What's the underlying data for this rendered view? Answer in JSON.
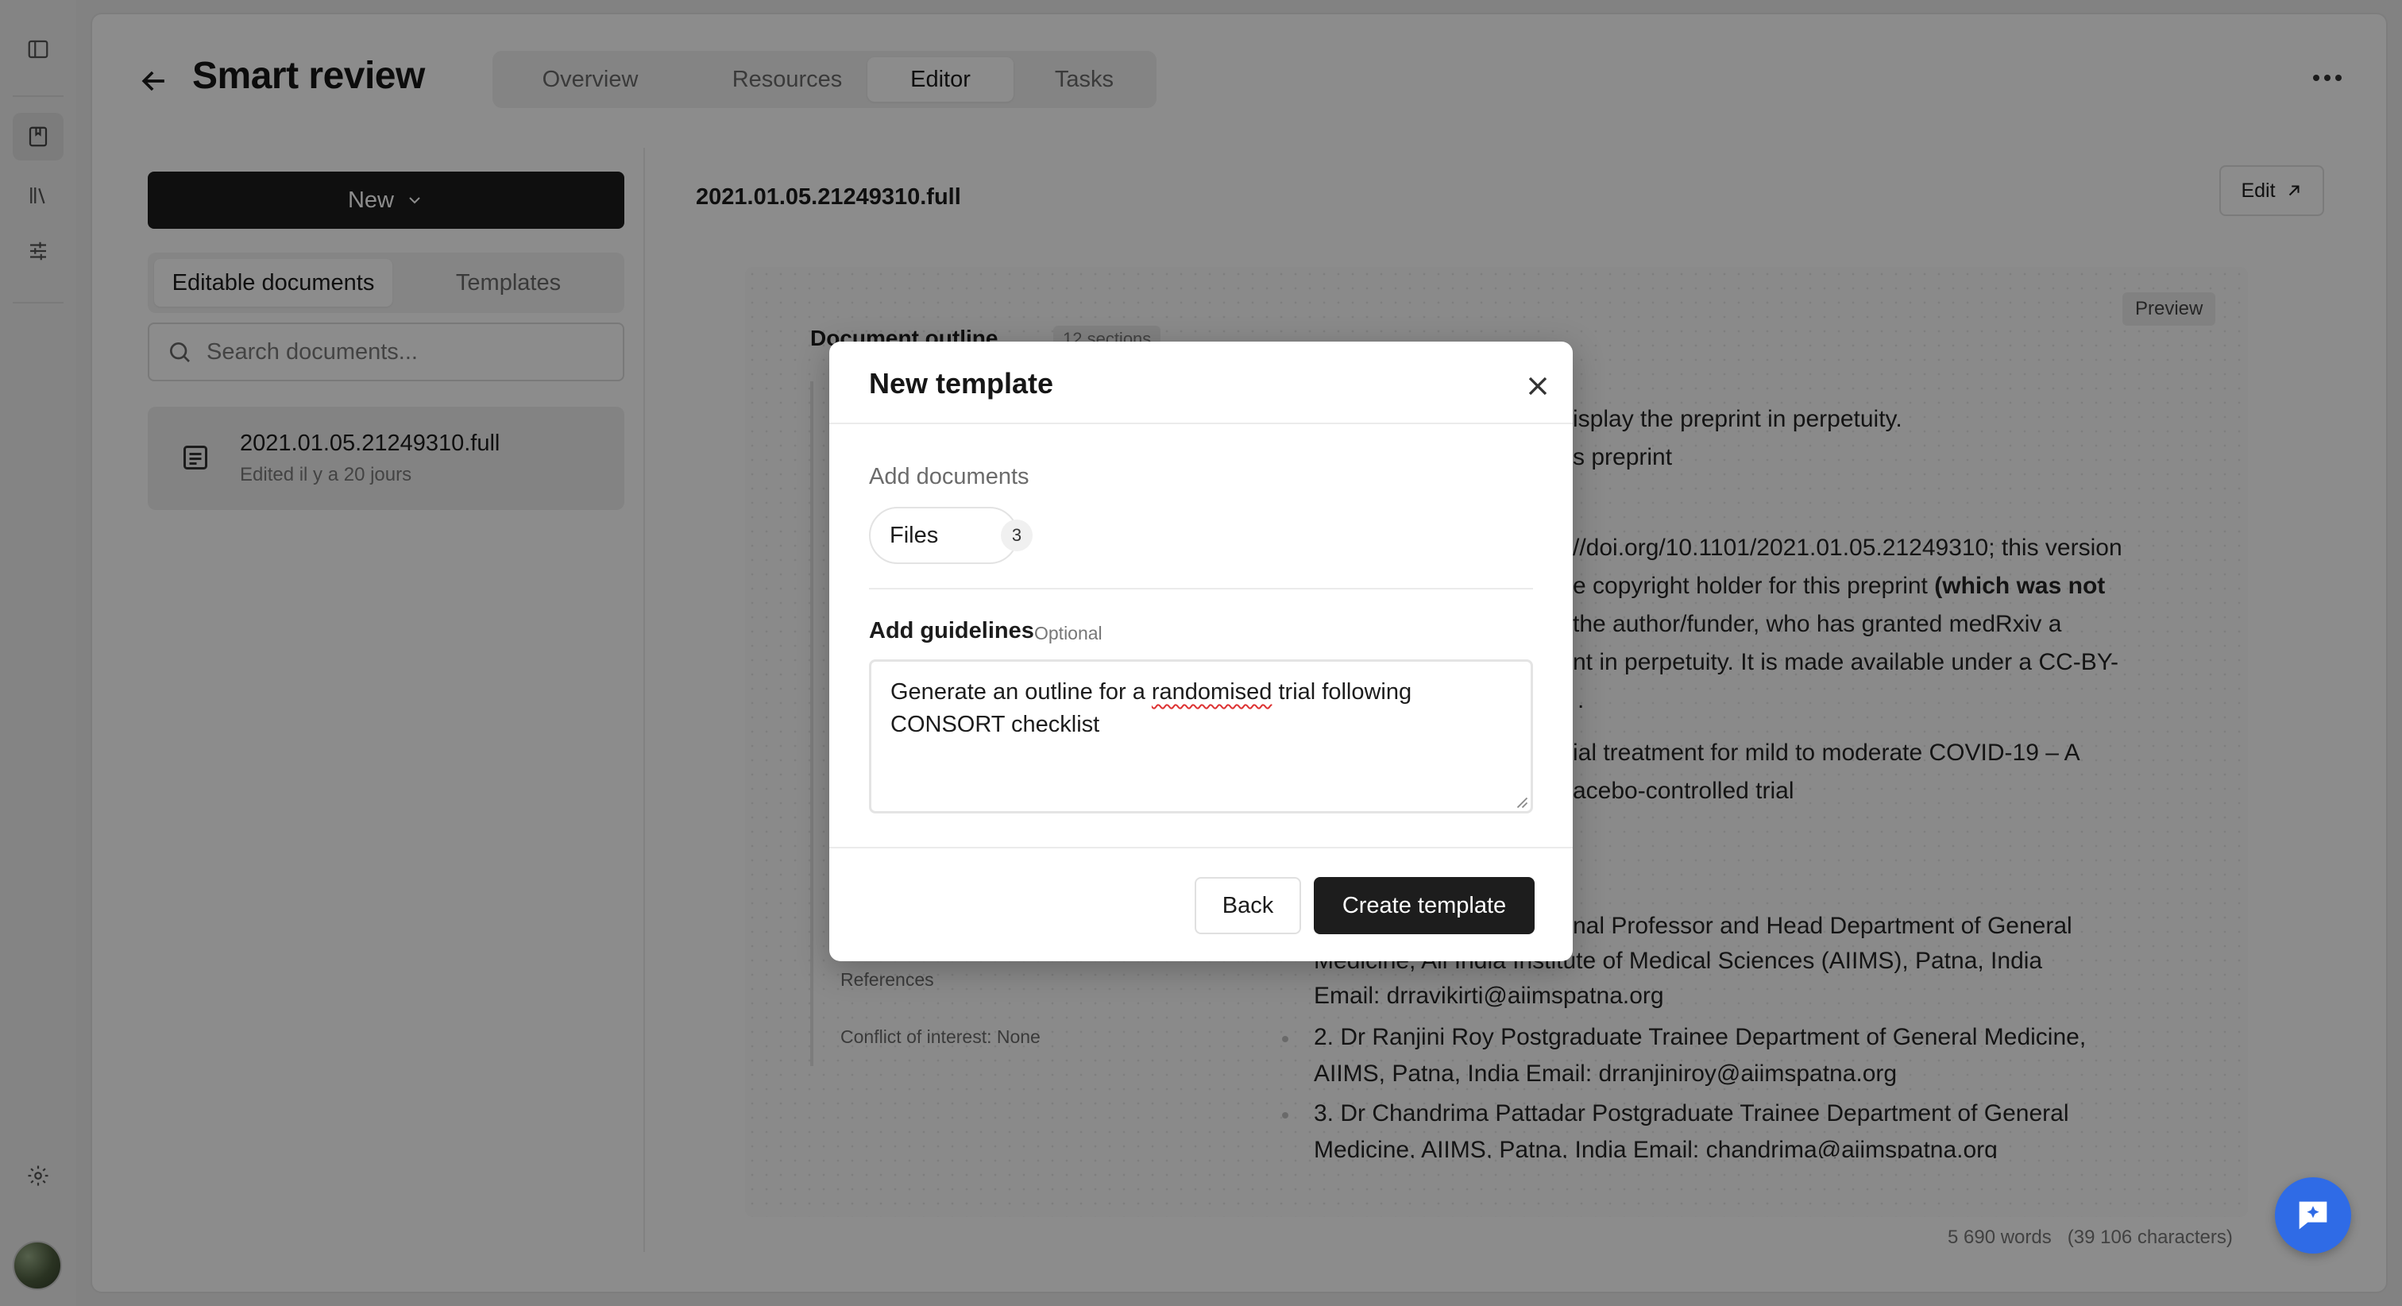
{
  "header": {
    "title": "Smart review",
    "tabs": [
      {
        "label": "Overview"
      },
      {
        "label": "Resources"
      },
      {
        "label": "Editor",
        "active": true
      },
      {
        "label": "Tasks"
      }
    ]
  },
  "left": {
    "new_label": "New",
    "segments": [
      "Editable documents",
      "Templates"
    ],
    "search_placeholder": "Search documents...",
    "doc": {
      "title": "2021.01.05.21249310.full",
      "subtitle": "Edited il y a 20 jours"
    }
  },
  "editor": {
    "doc_title": "2021.01.05.21249310.full",
    "edit_label": "Edit",
    "preview_label": "Preview",
    "outline_title": "Document outline",
    "outline_count": "12 sections",
    "outline_items": [
      "References",
      "Conflict of interest: None"
    ],
    "text_fragments": [
      "isplay the preprint in perpetuity.",
      "s preprint",
      "//doi.org/10.1101/2021.01.05.21249310; this version",
      "e copyright holder for this preprint",
      "(which was not",
      "the author/funder, who has granted medRxiv a",
      "nt in perpetuity. It is made available under a CC-BY-",
      ".",
      "ial treatment for mild to moderate COVID-19 – A",
      "acebo-controlled trial",
      "nal Professor and Head  Department of General",
      "Medicine, All India Institute of Medical Sciences (AIIMS), Patna, India",
      "Email:  drravikirti@aiimspatna.org",
      "2.   Dr Ranjini Roy  Postgraduate Trainee  Department of General Medicine,",
      "AIIMS, Patna, India   Email:  drranjiniroy@aiimspatna.org",
      "3.   Dr Chandrima Pattadar  Postgraduate Trainee  Department of General",
      "Medicine, AIIMS, Patna, India  Email:  chandrima@aiimspatna.org"
    ],
    "footer_words": "5 690 words",
    "footer_chars": "(39 106 characters)"
  },
  "modal": {
    "title": "New template",
    "add_documents_label": "Add documents",
    "files_label": "Files",
    "files_count": "3",
    "guidelines_label": "Add guidelines",
    "guidelines_optional": "Optional",
    "guidelines_text_pre": "Generate an outline for a ",
    "guidelines_text_misspelled": "randomised",
    "guidelines_text_post": " trial following\nCONSORT checklist",
    "back_label": "Back",
    "create_label": "Create template"
  },
  "colors": {
    "accent": "#2f6be6",
    "dark_button": "#1d1d1d"
  }
}
